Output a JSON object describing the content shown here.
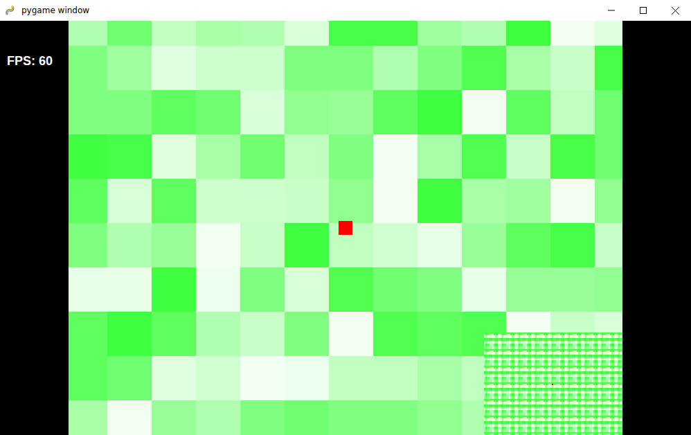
{
  "window": {
    "title": "pygame window"
  },
  "hud": {
    "fps": "FPS: 60"
  },
  "map": {
    "tiles": [
      [
        "#b0ffb0",
        "#70ff70",
        "#c0ffc0",
        "#a8ffa8",
        "#b0ffb0",
        "#d8ffd8",
        "#48ff48",
        "#48ff48",
        "#a0ffa0",
        "#b0ffb0",
        "#40ff40",
        "#f0fff0",
        "#e0ffe0"
      ],
      [
        "#80ff80",
        "#a0ffa0",
        "#e0ffe0",
        "#ccffcc",
        "#ccffcc",
        "#80ff80",
        "#80ff80",
        "#b0ffb0",
        "#80ff80",
        "#50ff50",
        "#a8ffa8",
        "#c8ffc8",
        "#48ff48"
      ],
      [
        "#80ff80",
        "#80ff80",
        "#60ff60",
        "#70ff70",
        "#d8ffd8",
        "#90ff90",
        "#98ff98",
        "#60ff60",
        "#40ff40",
        "#f0fff0",
        "#60ff60",
        "#c0ffc0",
        "#70ff70"
      ],
      [
        "#40ff40",
        "#48ff48",
        "#e0ffe0",
        "#a8ffa8",
        "#70ff70",
        "#c0ffc0",
        "#80ff80",
        "#f4fff4",
        "#a8ffa8",
        "#50ff50",
        "#c8ffc8",
        "#48ff48",
        "#70ff70"
      ],
      [
        "#60ff60",
        "#d8ffd8",
        "#60ff60",
        "#ccffcc",
        "#ccffcc",
        "#c8ffc8",
        "#90ff90",
        "#f0fff0",
        "#40ff40",
        "#a8ffa8",
        "#a0ffa0",
        "#f0fff0",
        "#90ff90"
      ],
      [
        "#80ff80",
        "#b0ffb0",
        "#98ff98",
        "#f0fff0",
        "#c8ffc8",
        "#40ff40",
        "#c0ffc0",
        "#d0ffd0",
        "#e8ffe8",
        "#98ff98",
        "#60ff60",
        "#48ff48",
        "#c8ffc8"
      ],
      [
        "#e8ffe8",
        "#e8ffe8",
        "#40ff40",
        "#ecffec",
        "#80ff80",
        "#d8ffd8",
        "#50ff50",
        "#70ff70",
        "#80ff80",
        "#e8ffe8",
        "#98ff98",
        "#98ff98",
        "#90ff90"
      ],
      [
        "#60ff60",
        "#40ff40",
        "#60ff60",
        "#b0ffb0",
        "#c8ffc8",
        "#80ff80",
        "#f0fff0",
        "#50ff50",
        "#60ff60",
        "#50ff50",
        "#f4fff4",
        "#c8ffc8",
        "#d8ffd8"
      ],
      [
        "#60ff60",
        "#70ff70",
        "#e0ffe0",
        "#d0ffd0",
        "#f4fff4",
        "#ecffec",
        "#c0ffc0",
        "#c0ffc0",
        "#a8ffa8",
        "#c0ffc0",
        "#90ff90",
        "#a0ffa0",
        "#80ff80"
      ],
      [
        "#a8ffa8",
        "#f0fff0",
        "#98ff98",
        "#b0ffb0",
        "#80ff80",
        "#70ff70",
        "#80ff80",
        "#80ff80",
        "#90ff90",
        "#b0ffb0",
        "#a0ffa0",
        "#c0ffc0",
        "#a0ffa0"
      ]
    ]
  }
}
